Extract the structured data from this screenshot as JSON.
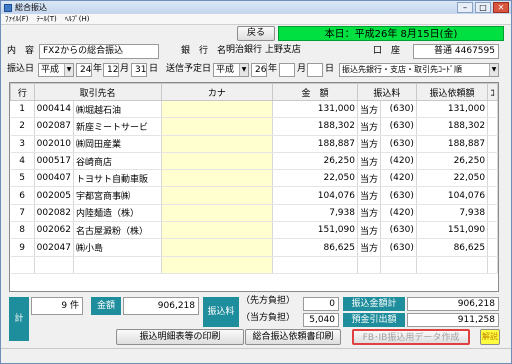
{
  "window": {
    "title": "総合振込"
  },
  "menu": [
    "ﾌｧｲﾙ(F)",
    "ﾃｰﾙ(T)",
    "ﾍﾙﾌﾟ(H)"
  ],
  "toolbar": {
    "back_label": "戻る",
    "today_banner": "本日：平成26年 8月15日(金)"
  },
  "header": {
    "content_label": "内　容",
    "content_value": "FX2からの総合振込",
    "bank_label": "銀　行　名",
    "bank_value": "明治銀行 上野支店",
    "account_label": "口　座",
    "account_value": "普通 4467595",
    "transfer_date_label": "振込日",
    "era1": "平成",
    "year1": "24",
    "year_unit": "年",
    "month1": "12",
    "month_unit": "月",
    "day1": "31",
    "day_unit": "日",
    "send_date_label": "送信予定日",
    "era2": "平成",
    "year2": "26",
    "month2": "",
    "day2": "",
    "sort_value": "振込先銀行・支店・取引先ｺｰﾄﾞ順"
  },
  "table": {
    "columns": [
      "行",
      "取引先名",
      "カナ",
      "金　額",
      "振込料",
      "振込依頼額",
      "ｺ"
    ],
    "rows": [
      {
        "row": "1",
        "code": "000414",
        "name": "㈱堀越石油",
        "kana": "",
        "amount": "131,000",
        "fee_type": "当方",
        "fee": "(630)",
        "request": "131,000"
      },
      {
        "row": "2",
        "code": "002087",
        "name": "新座ミートサービ",
        "kana": "",
        "amount": "188,302",
        "fee_type": "当方",
        "fee": "(630)",
        "request": "188,302"
      },
      {
        "row": "3",
        "code": "002010",
        "name": "㈱岡田産業",
        "kana": "",
        "amount": "188,887",
        "fee_type": "当方",
        "fee": "(630)",
        "request": "188,887"
      },
      {
        "row": "4",
        "code": "000517",
        "name": "谷崎商店",
        "kana": "",
        "amount": "26,250",
        "fee_type": "当方",
        "fee": "(420)",
        "request": "26,250"
      },
      {
        "row": "5",
        "code": "000407",
        "name": "トヨサト自動車販",
        "kana": "",
        "amount": "22,050",
        "fee_type": "当方",
        "fee": "(420)",
        "request": "22,050"
      },
      {
        "row": "6",
        "code": "002005",
        "name": "宇都宮商事㈱",
        "kana": "",
        "amount": "104,076",
        "fee_type": "当方",
        "fee": "(630)",
        "request": "104,076"
      },
      {
        "row": "7",
        "code": "002082",
        "name": "内陸麺造（株）",
        "kana": "",
        "amount": "7,938",
        "fee_type": "当方",
        "fee": "(420)",
        "request": "7,938"
      },
      {
        "row": "8",
        "code": "002062",
        "name": "名古屋澱粉（株）",
        "kana": "",
        "amount": "151,090",
        "fee_type": "当方",
        "fee": "(630)",
        "request": "151,090"
      },
      {
        "row": "9",
        "code": "002047",
        "name": "㈱小島",
        "kana": "",
        "amount": "86,625",
        "fee_type": "当方",
        "fee": "(630)",
        "request": "86,625"
      }
    ]
  },
  "totals": {
    "count_label": "計",
    "count_value": "9 件",
    "amount_label": "金額",
    "amount_value": "906,218",
    "fee_label": "振込料",
    "sender_fee_label": "（先方負担）",
    "sender_fee_value": "0",
    "our_fee_label": "（当方負担）",
    "our_fee_value": "5,040",
    "total_label": "振込金額計",
    "total_value": "906,218",
    "deposit_label": "預金引出額",
    "deposit_value": "911,258"
  },
  "buttons": {
    "print_detail": "振込明細表等の印刷",
    "print_request": "総合振込依頼書印刷",
    "create_data": "FB･IB振込用データ作成",
    "help": "解説"
  },
  "colors": {
    "banner": "#00e040",
    "kana_bg": "#ffffd0",
    "teal": "#1e8d9c"
  }
}
